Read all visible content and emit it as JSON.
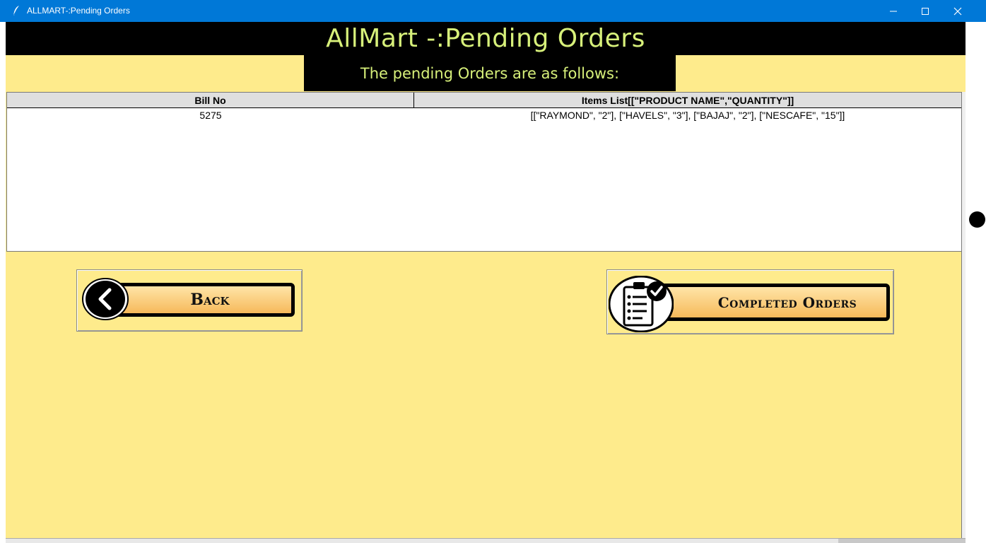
{
  "window": {
    "title": "ALLMART-:Pending Orders",
    "minimize_icon": "minimize-icon",
    "maximize_icon": "maximize-icon",
    "close_icon": "close-icon"
  },
  "header": {
    "title": "AllMart -:Pending Orders",
    "subtitle": "The pending Orders are as follows:"
  },
  "table": {
    "columns": [
      "Bill No",
      "Items List[[\"PRODUCT NAME\",\"QUANTITY\"]]"
    ],
    "rows": [
      [
        "5275",
        "[[\"RAYMOND\", \"2\"], [\"HAVELS\", \"3\"], [\"BAJAJ\", \"2\"], [\"NESCAFE\", \"15\"]]"
      ]
    ]
  },
  "buttons": {
    "back_label": "Back",
    "completed_label": "Completed Orders"
  },
  "colors": {
    "background": "#feeb8c",
    "header_bg": "#000000",
    "header_text": "#d7f07a",
    "titlebar": "#0078d7"
  }
}
